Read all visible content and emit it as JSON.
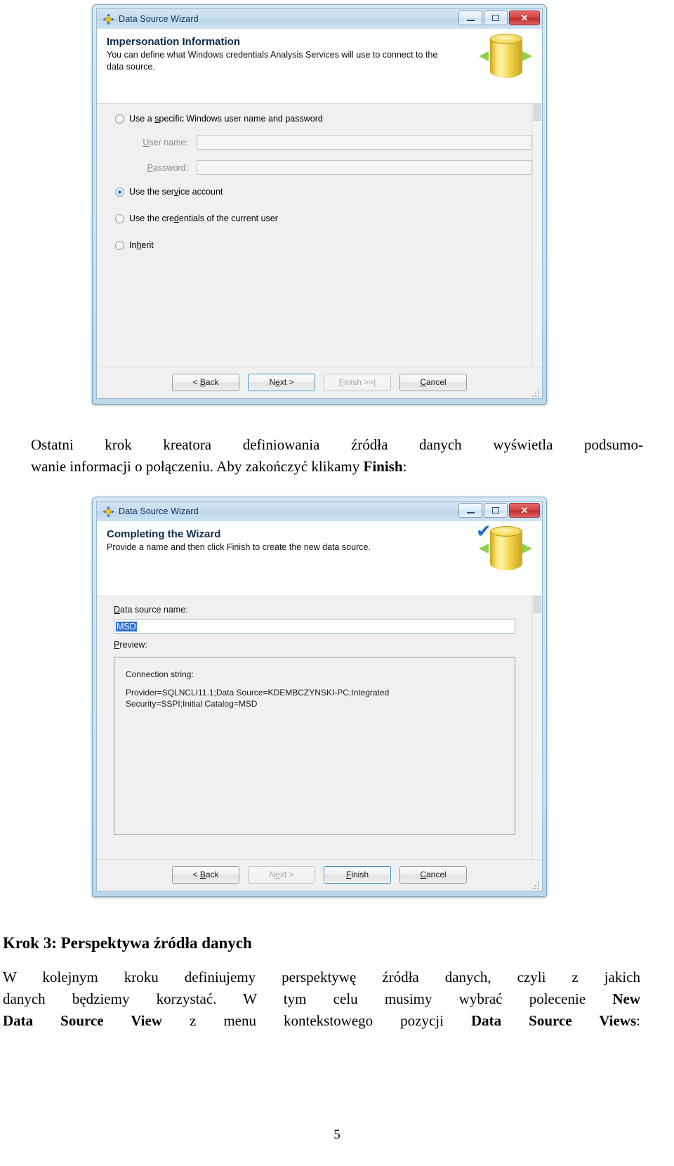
{
  "document": {
    "page_number": "5",
    "paragraph_1": {
      "line1": "Ostatni krok kreatora definiowania źródła danych wyświetla podsumo-",
      "line2_a": "wanie informacji o połączeniu. Aby zakończyć klikamy ",
      "line2_b": "Finish",
      "line2_c": ":"
    },
    "heading": "Krok 3: Perspektywa źródła danych",
    "paragraph_2": {
      "line1": "W kolejnym kroku definiujemy perspektywę źródła danych, czyli z jakich",
      "line2_a": "danych będziemy korzystać. W tym celu musimy wybrać polecenie ",
      "line2_b": "New",
      "line3_a": "Data Source View",
      "line3_b": " z menu kontekstowego pozycji ",
      "line3_c": "Data Source Views",
      "line3_d": ":"
    }
  },
  "dialog1": {
    "title": "Data Source Wizard",
    "window_buttons": {
      "minimize": "minimize-icon",
      "maximize": "maximize-icon",
      "close": "✕"
    },
    "header": {
      "title": "Impersonation Information",
      "subtitle": "You can define what Windows credentials Analysis Services will use to connect to the data source."
    },
    "options": [
      {
        "label_pre": "Use a ",
        "label_u": "s",
        "label_post": "pecific Windows user name and password",
        "checked": false
      },
      {
        "label_pre": "Use the ser",
        "label_u": "v",
        "label_post": "ice account",
        "checked": true
      },
      {
        "label_pre": "Use the cre",
        "label_u": "d",
        "label_post": "entials of the current user",
        "checked": false
      },
      {
        "label_pre": "In",
        "label_u": "h",
        "label_post": "erit",
        "checked": false
      }
    ],
    "fields": [
      {
        "label_u": "U",
        "label_rest": "ser name:",
        "value": "",
        "enabled": false
      },
      {
        "label_u": "P",
        "label_rest": "assword:",
        "value": "",
        "enabled": false
      }
    ],
    "buttons": [
      {
        "pre": "< ",
        "u": "B",
        "post": "ack",
        "state": "normal"
      },
      {
        "pre": "N",
        "u": "e",
        "post": "xt >",
        "state": "default"
      },
      {
        "pre": "",
        "u": "F",
        "post": "inish >>|",
        "state": "disabled"
      },
      {
        "pre": "",
        "u": "C",
        "post": "ancel",
        "state": "normal"
      }
    ]
  },
  "dialog2": {
    "title": "Data Source Wizard",
    "window_buttons": {
      "minimize": "minimize-icon",
      "maximize": "maximize-icon",
      "close": "✕"
    },
    "header": {
      "title": "Completing the Wizard",
      "subtitle": "Provide a name and then click Finish to create the new data source."
    },
    "data_source_name": {
      "label_u": "D",
      "label_rest": "ata source name:",
      "value": "MSD",
      "selected": true
    },
    "preview": {
      "label_u": "P",
      "label_rest": "review:",
      "connection_label_pre": "Connection strin",
      "connection_label_u": "g",
      "connection_label_post": ":",
      "connection_line1": "Provider=SQLNCLI11.1;Data Source=KDEMBCZYNSKI-PC;Integrated",
      "connection_line2": "Security=SSPI;Initial Catalog=MSD"
    },
    "buttons": [
      {
        "pre": "< ",
        "u": "B",
        "post": "ack",
        "state": "normal"
      },
      {
        "pre": "N",
        "u": "e",
        "post": "xt >",
        "state": "disabled"
      },
      {
        "pre": "",
        "u": "F",
        "post": "inish",
        "state": "default"
      },
      {
        "pre": "",
        "u": "C",
        "post": "ancel",
        "state": "normal"
      }
    ]
  },
  "colors": {
    "accent_blue": "#2f7fc4",
    "selection_blue": "#2d6fd4",
    "title_text": "#14335c",
    "close_red": "#bf2b2b",
    "cylinder_yellow": "#f3da5c",
    "arrow_green": "#8ed04a"
  }
}
